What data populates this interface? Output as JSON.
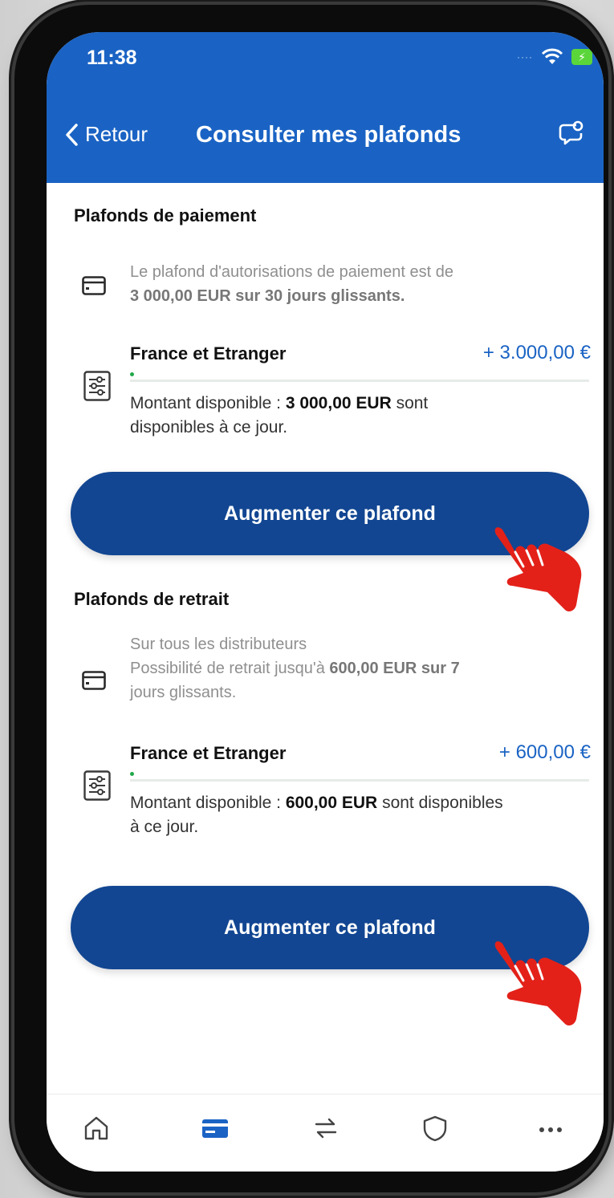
{
  "status_bar": {
    "time": "11:38"
  },
  "nav": {
    "back_label": "Retour",
    "title": "Consulter mes plafonds"
  },
  "payment": {
    "section_title": "Plafonds de paiement",
    "info_line1": "Le plafond d'autorisations de paiement est de",
    "info_line2": "3 000,00 EUR sur 30 jours glissants.",
    "limit_label": "France et Etranger",
    "limit_amount": "+ 3.000,00 €",
    "avail_prefix": "Montant disponible :",
    "avail_value": "3 000,00 EUR",
    "avail_suffix": "sont",
    "avail_line2": "disponibles à ce jour.",
    "used_fraction": 0.0,
    "button_label": "Augmenter ce plafond"
  },
  "withdrawal": {
    "section_title": "Plafonds de retrait",
    "info_line1": "Sur tous les distributeurs",
    "info_line2_prefix": "Possibilité de retrait jusqu'à",
    "info_line2_value": "600,00 EUR sur 7",
    "info_line3": "jours glissants.",
    "limit_label": "France et Etranger",
    "limit_amount": "+ 600,00 €",
    "avail_prefix": "Montant disponible :",
    "avail_value": "600,00 EUR",
    "avail_suffix": "sont disponibles",
    "avail_line2": "à ce jour.",
    "used_fraction": 0.0,
    "button_label": "Augmenter ce plafond"
  },
  "tabs": [
    "home-icon",
    "card-icon",
    "transfer-icon",
    "shield-icon",
    "more-icon"
  ],
  "colors": {
    "brand_blue": "#1a63c4",
    "button_blue": "#124692",
    "progress_green": "#2dbb52",
    "pointer_red": "#e32119"
  }
}
